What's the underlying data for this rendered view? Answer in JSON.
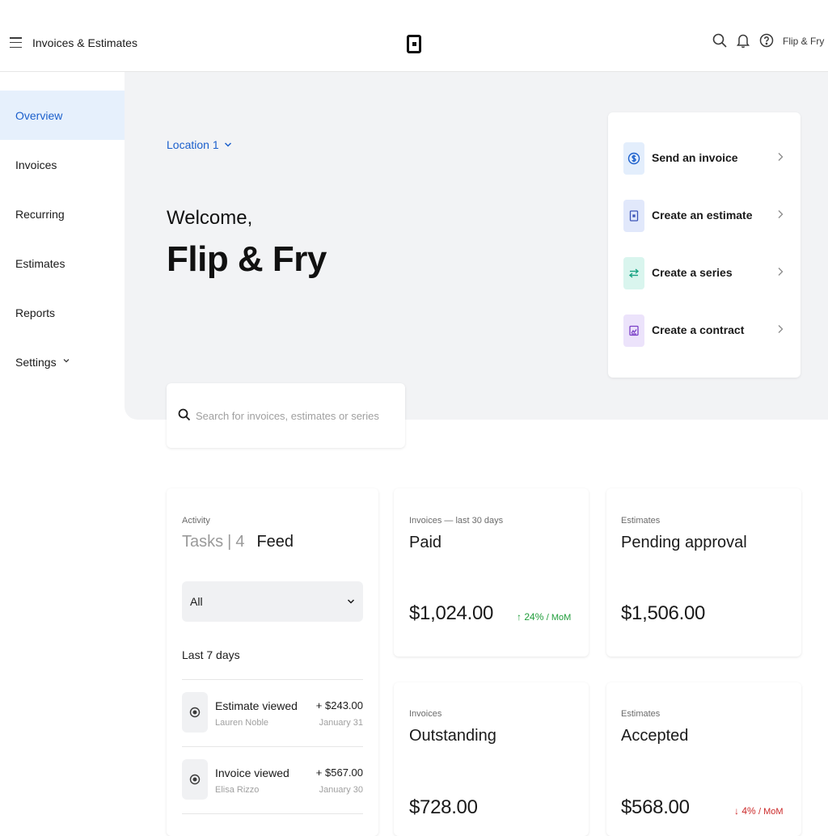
{
  "topbar": {
    "app_title": "Invoices & Estimates",
    "account_name": "Flip & Fry"
  },
  "sidebar": {
    "items": [
      {
        "label": "Overview",
        "active": true
      },
      {
        "label": "Invoices"
      },
      {
        "label": "Recurring"
      },
      {
        "label": "Estimates"
      },
      {
        "label": "Reports"
      },
      {
        "label": "Settings"
      }
    ]
  },
  "hero": {
    "location": "Location 1",
    "welcome": "Welcome,",
    "business_name": "Flip & Fry"
  },
  "actions": [
    {
      "label": "Send an invoice",
      "icon": "dollar-circle-icon",
      "color": "#e3eefc"
    },
    {
      "label": "Create an estimate",
      "icon": "document-icon",
      "color": "#e1e8fb"
    },
    {
      "label": "Create a series",
      "icon": "swap-arrows-icon",
      "color": "#d9f5ee"
    },
    {
      "label": "Create a contract",
      "icon": "contract-icon",
      "color": "#ece3fb"
    }
  ],
  "search": {
    "placeholder": "Search for invoices, estimates or series"
  },
  "activity": {
    "eyebrow": "Activity",
    "tab_tasks": "Tasks",
    "tab_count": "4",
    "tab_feed": "Feed",
    "filter_value": "All",
    "period_label": "Last 7 days",
    "items": [
      {
        "title": "Estimate viewed",
        "name": "Lauren Noble",
        "amount": "+ $243.00",
        "date": "January 31"
      },
      {
        "title": "Invoice viewed",
        "name": "Elisa Rizzo",
        "amount": "+ $567.00",
        "date": "January 30"
      }
    ]
  },
  "metrics": {
    "paid": {
      "eyebrow": "Invoices — last 30 days",
      "title": "Paid",
      "amount": "$1,024.00",
      "trend": "24%",
      "trend_unit": "/ MoM",
      "trend_direction": "up"
    },
    "pending": {
      "eyebrow": "Estimates",
      "title": "Pending approval",
      "amount": "$1,506.00"
    },
    "outstanding": {
      "eyebrow": "Invoices",
      "title": "Outstanding",
      "amount": "$728.00"
    },
    "accepted": {
      "eyebrow": "Estimates",
      "title": "Accepted",
      "amount": "$568.00",
      "trend": "4%",
      "trend_unit": "/ MoM",
      "trend_direction": "down"
    }
  },
  "colors": {
    "accent": "#1b5fcc",
    "active_nav_bg": "#e6f0fc",
    "hero_bg": "#f2f3f5",
    "trend_up": "#1f9d3a",
    "trend_down": "#cc2a2a"
  }
}
